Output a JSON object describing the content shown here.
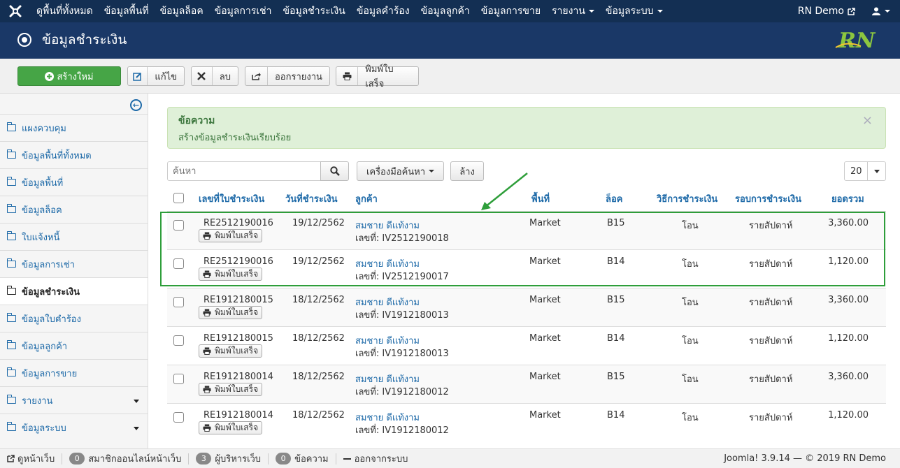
{
  "topnav": {
    "menu": [
      {
        "label": "ดูพื้นที่ทั้งหมด",
        "caret": false
      },
      {
        "label": "ข้อมูลพื้นที่",
        "caret": false
      },
      {
        "label": "ข้อมูลล็อค",
        "caret": false
      },
      {
        "label": "ข้อมูลการเช่า",
        "caret": false
      },
      {
        "label": "ข้อมูลชำระเงิน",
        "caret": false
      },
      {
        "label": "ข้อมูลคำร้อง",
        "caret": false
      },
      {
        "label": "ข้อมูลลูกค้า",
        "caret": false
      },
      {
        "label": "ข้อมูลการขาย",
        "caret": false
      },
      {
        "label": "รายงาน",
        "caret": true
      },
      {
        "label": "ข้อมูลระบบ",
        "caret": true
      }
    ],
    "site_name": "RN Demo"
  },
  "header": {
    "title": "ข้อมูลชำระเงิน",
    "brand_text": "RN"
  },
  "toolbar": {
    "new_label": "สร้างใหม่",
    "edit_label": "แก้ไข",
    "delete_label": "ลบ",
    "export_label": "ออกรายงาน",
    "print_label": "พิมพ์ใบเสร็จ"
  },
  "sidebar": {
    "items": [
      {
        "label": "แผงควบคุม",
        "active": false,
        "caret": false
      },
      {
        "label": "ข้อมูลพื้นที่ทั้งหมด",
        "active": false,
        "caret": false
      },
      {
        "label": "ข้อมูลพื้นที่",
        "active": false,
        "caret": false
      },
      {
        "label": "ข้อมูลล็อค",
        "active": false,
        "caret": false
      },
      {
        "label": "ใบแจ้งหนี้",
        "active": false,
        "caret": false
      },
      {
        "label": "ข้อมูลการเช่า",
        "active": false,
        "caret": false
      },
      {
        "label": "ข้อมูลชำระเงิน",
        "active": true,
        "caret": false
      },
      {
        "label": "ข้อมูลใบคำร้อง",
        "active": false,
        "caret": false
      },
      {
        "label": "ข้อมูลลูกค้า",
        "active": false,
        "caret": false
      },
      {
        "label": "ข้อมูลการขาย",
        "active": false,
        "caret": false
      },
      {
        "label": "รายงาน",
        "active": false,
        "caret": true
      },
      {
        "label": "ข้อมูลระบบ",
        "active": false,
        "caret": true
      }
    ]
  },
  "alert": {
    "heading": "ข้อความ",
    "message": "สร้างข้อมูลชำระเงินเรียบร้อย",
    "close": "×"
  },
  "filters": {
    "search_placeholder": "ค้นหา",
    "search_value": "",
    "tools_label": "เครื่องมือค้นหา",
    "clear_label": "ล้าง",
    "limit_value": "20"
  },
  "table": {
    "headers": {
      "receipt_no": "เลขที่ใบชำระเงิน",
      "pay_date": "วันที่ชำระเงิน",
      "customer": "ลูกค้า",
      "area": "พื้นที่",
      "lock": "ล็อค",
      "method": "วิธีการชำระเงิน",
      "cycle": "รอบการชำระเงิน",
      "total": "ยอดรวม"
    },
    "print_button_label": "พิมพ์ใบเสร็จ",
    "rows": [
      {
        "receipt_no": "RE2512190016",
        "pay_date": "19/12/2562",
        "customer": "สมชาย ดีแท้งาม",
        "invoice": "เลขที่: IV2512190018",
        "area": "Market",
        "lock": "B15",
        "method": "โอน",
        "cycle": "รายสัปดาห์",
        "total": "3,360.00"
      },
      {
        "receipt_no": "RE2512190016",
        "pay_date": "19/12/2562",
        "customer": "สมชาย ดีแท้งาม",
        "invoice": "เลขที่: IV2512190017",
        "area": "Market",
        "lock": "B14",
        "method": "โอน",
        "cycle": "รายสัปดาห์",
        "total": "1,120.00"
      },
      {
        "receipt_no": "RE1912180015",
        "pay_date": "18/12/2562",
        "customer": "สมชาย ดีแท้งาม",
        "invoice": "เลขที่: IV1912180013",
        "area": "Market",
        "lock": "B15",
        "method": "โอน",
        "cycle": "รายสัปดาห์",
        "total": "3,360.00"
      },
      {
        "receipt_no": "RE1912180015",
        "pay_date": "18/12/2562",
        "customer": "สมชาย ดีแท้งาม",
        "invoice": "เลขที่: IV1912180013",
        "area": "Market",
        "lock": "B14",
        "method": "โอน",
        "cycle": "รายสัปดาห์",
        "total": "1,120.00"
      },
      {
        "receipt_no": "RE1912180014",
        "pay_date": "18/12/2562",
        "customer": "สมชาย ดีแท้งาม",
        "invoice": "เลขที่: IV1912180012",
        "area": "Market",
        "lock": "B15",
        "method": "โอน",
        "cycle": "รายสัปดาห์",
        "total": "3,360.00"
      },
      {
        "receipt_no": "RE1912180014",
        "pay_date": "18/12/2562",
        "customer": "สมชาย ดีแท้งาม",
        "invoice": "เลขที่: IV1912180012",
        "area": "Market",
        "lock": "B14",
        "method": "โอน",
        "cycle": "รายสัปดาห์",
        "total": "1,120.00"
      }
    ]
  },
  "statusbar": {
    "view_site": "ดูหน้าเว็บ",
    "online_count": "0",
    "online_label": "สมาชิกออนไลน์หน้าเว็บ",
    "admin_count": "3",
    "admin_label": "ผู้บริหารเว็บ",
    "msg_count": "0",
    "msg_label": "ข้อความ",
    "logout": "ออกจากระบบ",
    "copyright": "Joomla! 3.9.14  —  © 2019 RN Demo"
  },
  "colors": {
    "topnav_bg": "#132f53",
    "header_bg": "#1a3867",
    "new_button": "#46a546",
    "link": "#1e6aa8",
    "highlight": "#2e9e3a",
    "alert_bg": "#dff0d8"
  }
}
